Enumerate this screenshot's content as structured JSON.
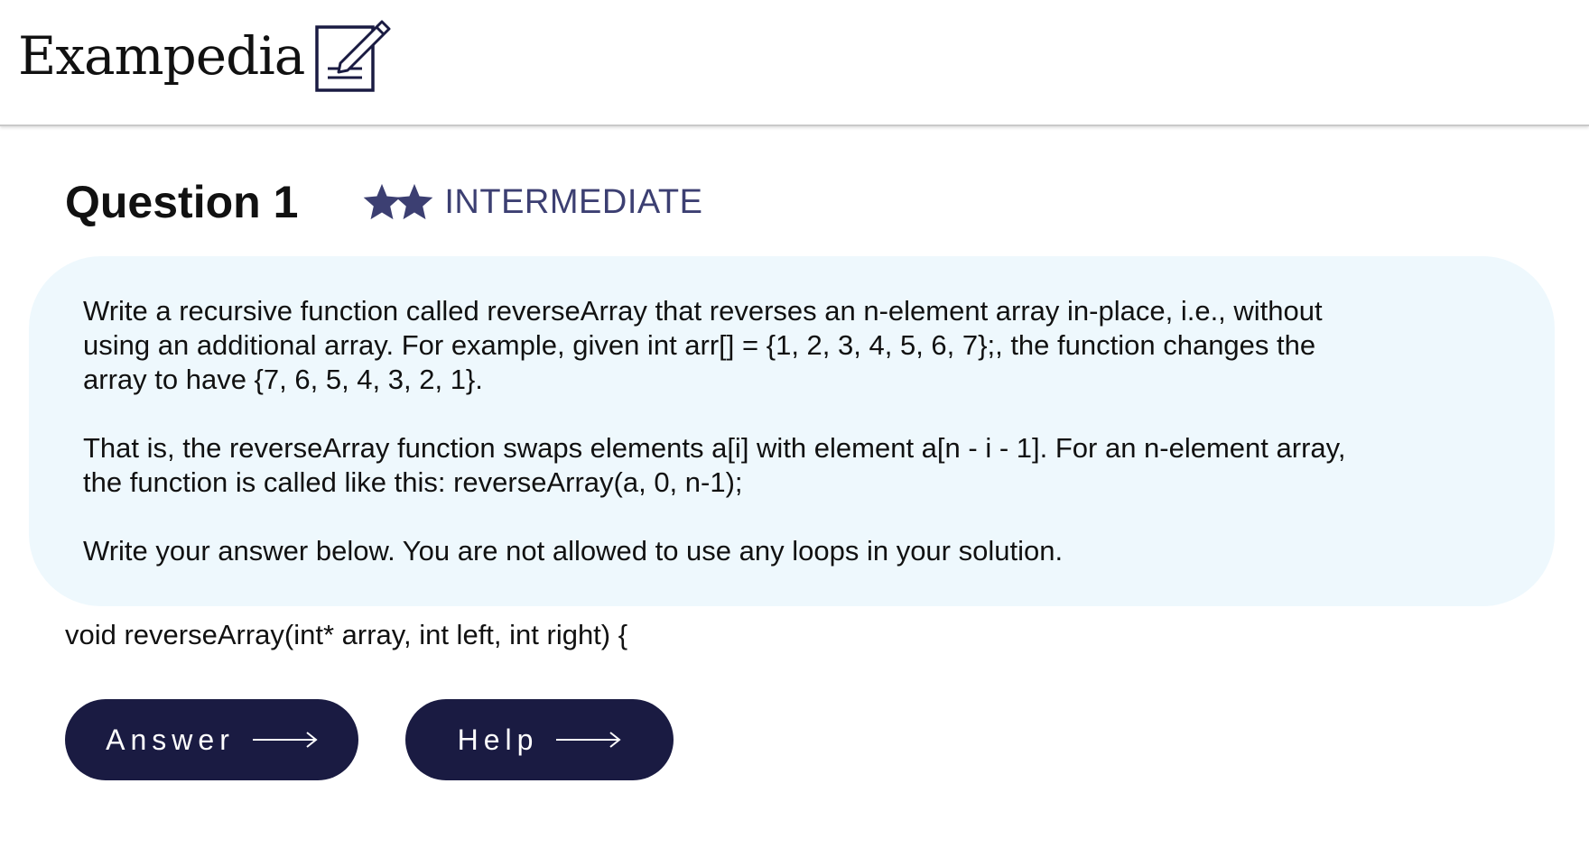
{
  "brand": {
    "name": "Exampedia",
    "logo_icon": "notepad-pen-icon"
  },
  "question": {
    "title": "Question 1",
    "difficulty_label": "INTERMEDIATE",
    "difficulty_stars": 2,
    "star_color": "#3c3f72",
    "paragraphs": [
      "Write a recursive function called reverseArray that reverses an n-element array in-place, i.e., without using an additional array. For example, given int arr[] = {1, 2, 3, 4, 5, 6, 7};, the function changes the array to have {7, 6, 5, 4, 3, 2, 1}.",
      "That is, the reverseArray function swaps elements a[i] with element a[n - i - 1]. For an n-element array, the function is called like this: reverseArray(a, 0, n-1);",
      "Write your answer below. You are not allowed to use any loops in your solution."
    ],
    "box_color": "#eef8fd"
  },
  "code": {
    "signature": "void reverseArray(int* array, int left, int right) {"
  },
  "buttons": {
    "answer_label": "Answer",
    "help_label": "Help",
    "arrow_icon": "right-arrow-icon",
    "color": "#1a1b42"
  }
}
